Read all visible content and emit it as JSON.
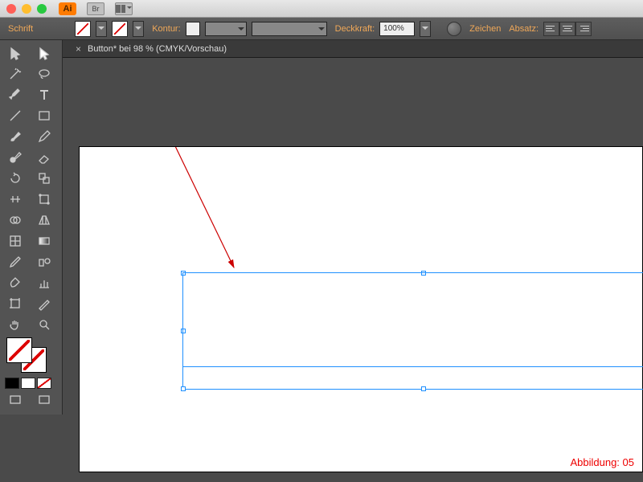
{
  "app": {
    "name": "Ai",
    "br": "Br"
  },
  "control": {
    "schrift": "Schrift",
    "kontur": "Kontur:",
    "deckkraft": "Deckkraft:",
    "opacity": "100%",
    "zeichen": "Zeichen",
    "absatz": "Absatz:"
  },
  "doc": {
    "title": "Button* bei 98 % (CMYK/Vorschau)"
  },
  "figure_label": "Abbildung: 05",
  "tools": [
    [
      "selection-tool",
      "direct-selection-tool"
    ],
    [
      "magic-wand-tool",
      "lasso-tool"
    ],
    [
      "pen-tool",
      "type-tool"
    ],
    [
      "line-tool",
      "rectangle-tool"
    ],
    [
      "paintbrush-tool",
      "pencil-tool"
    ],
    [
      "blob-brush-tool",
      "eraser-tool"
    ],
    [
      "rotate-tool",
      "scale-tool"
    ],
    [
      "width-tool",
      "free-transform-tool"
    ],
    [
      "shape-builder-tool",
      "perspective-tool"
    ],
    [
      "mesh-tool",
      "gradient-tool"
    ],
    [
      "eyedropper-tool",
      "blend-tool"
    ],
    [
      "symbol-sprayer-tool",
      "graph-tool"
    ],
    [
      "artboard-tool",
      "slice-tool"
    ],
    [
      "hand-tool",
      "zoom-tool"
    ]
  ]
}
